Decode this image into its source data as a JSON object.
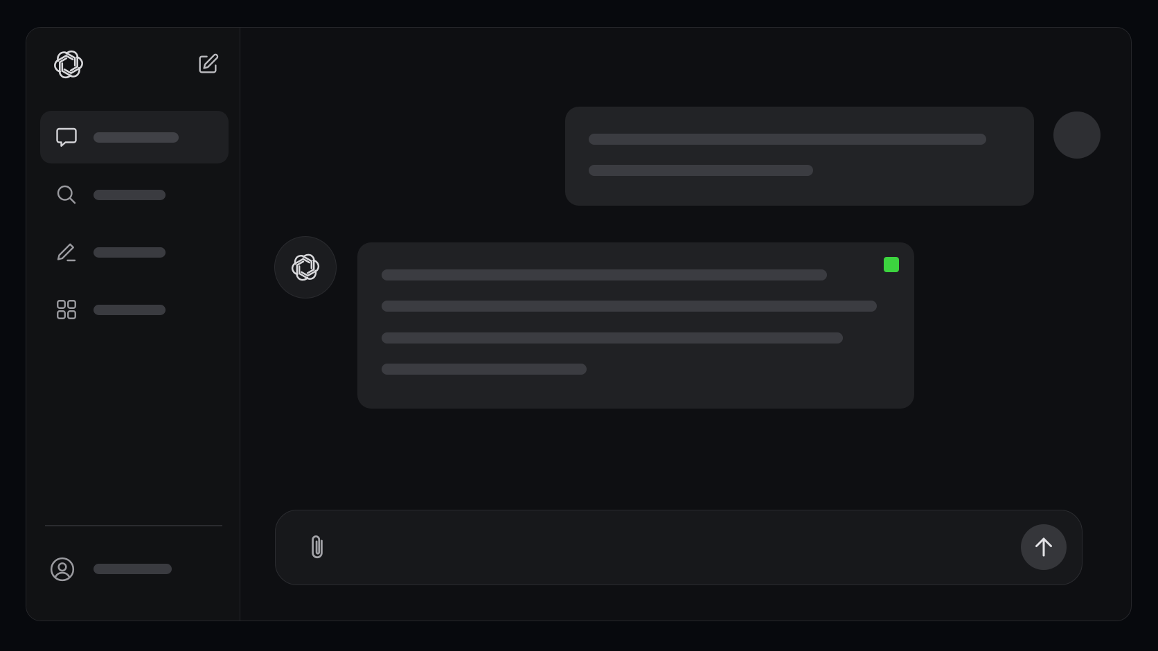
{
  "app": {
    "theme": "dark"
  },
  "colors": {
    "background": "#07090d",
    "window": "#0e0f12",
    "sidebar": "#111214",
    "active_item": "#1f2023",
    "bubble": "#222326",
    "status_indicator": "#3cd43f"
  },
  "sidebar": {
    "logo_icon": "openai-logo-icon",
    "new_chat_icon": "edit-square-icon",
    "items": [
      {
        "icon": "chat-bubble-icon",
        "label": "",
        "active": true
      },
      {
        "icon": "search-icon",
        "label": "",
        "active": false
      },
      {
        "icon": "pencil-icon",
        "label": "",
        "active": false
      },
      {
        "icon": "grid-icon",
        "label": "",
        "active": false
      }
    ],
    "account": {
      "icon": "user-circle-icon",
      "label": ""
    }
  },
  "chat": {
    "messages": [
      {
        "role": "user",
        "text": "",
        "avatar_icon": "user-avatar"
      },
      {
        "role": "assistant",
        "text": "",
        "avatar_icon": "openai-logo-icon",
        "status_indicator": "green-square"
      }
    ]
  },
  "composer": {
    "placeholder": "",
    "value": "",
    "attach_icon": "paperclip-icon",
    "send_icon": "arrow-up-icon"
  }
}
